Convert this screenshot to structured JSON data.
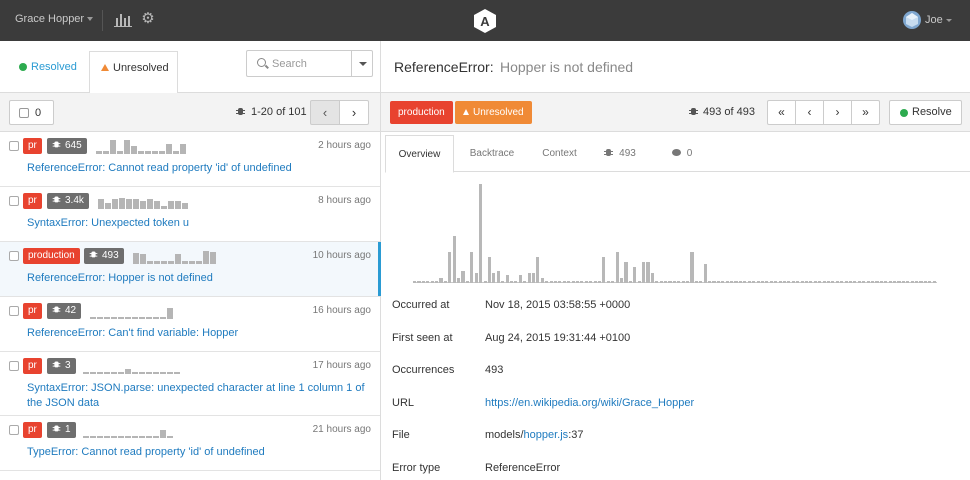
{
  "topbar": {
    "org_name": "Grace Hopper",
    "user_name": "Joe",
    "icons": [
      "stats-icon",
      "gear-icon",
      "app-logo",
      "user-avatar"
    ]
  },
  "left": {
    "tabs": {
      "resolved": "Resolved",
      "unresolved": "Unresolved"
    },
    "search": {
      "placeholder": "Search"
    },
    "list_header": {
      "selected_count": "0",
      "range": "1-20 of 101",
      "prev": "‹",
      "next": "›"
    },
    "issues": [
      {
        "env": "pr",
        "count": "645",
        "time": "2 hours ago",
        "title": "ReferenceError: Cannot read property 'id' of undefined",
        "spark": [
          0.2,
          0.2,
          0.9,
          0.2,
          0.85,
          0.5,
          0.2,
          0.2,
          0.2,
          0.2,
          0.65,
          0.2,
          0.65
        ]
      },
      {
        "env": "pr",
        "count": "3.4k",
        "time": "8 hours ago",
        "title": "SyntaxError: Unexpected token u",
        "spark": [
          0.6,
          0.4,
          0.6,
          0.7,
          0.6,
          0.6,
          0.5,
          0.6,
          0.5,
          0.2,
          0.5,
          0.5,
          0.4
        ]
      },
      {
        "env": "production",
        "count": "493",
        "time": "10 hours ago",
        "title": "ReferenceError: Hopper is not defined",
        "spark": [
          0.7,
          0.6,
          0.2,
          0.2,
          0.2,
          0.2,
          0.6,
          0.2,
          0.2,
          0.2,
          0.8,
          0.75
        ]
      },
      {
        "env": "pr",
        "count": "42",
        "time": "16 hours ago",
        "title": "ReferenceError: Can't find variable: Hopper",
        "spark": [
          0.1,
          0.1,
          0.1,
          0.1,
          0.1,
          0.1,
          0.1,
          0.1,
          0.1,
          0.1,
          0.1,
          0.7
        ]
      },
      {
        "env": "pr",
        "count": "3",
        "time": "17 hours ago",
        "title": "SyntaxError: JSON.parse: unexpected character at line 1 column 1 of the JSON data",
        "spark": [
          0.1,
          0.1,
          0.1,
          0.1,
          0.1,
          0.1,
          0.3,
          0.1,
          0.1,
          0.1,
          0.1,
          0.1,
          0.1,
          0.1
        ]
      },
      {
        "env": "pr",
        "count": "1",
        "time": "21 hours ago",
        "title": "TypeError: Cannot read property 'id' of undefined",
        "spark": [
          0.1,
          0.1,
          0.1,
          0.1,
          0.1,
          0.1,
          0.1,
          0.1,
          0.1,
          0.1,
          0.1,
          0.5,
          0.1
        ]
      }
    ]
  },
  "right": {
    "error_type": "ReferenceError:",
    "error_message": "Hopper is not defined",
    "env_badge": "production",
    "status_badge": "Unresolved",
    "occurrence_position": "493 of 493",
    "nav": {
      "first": "«",
      "prev": "‹",
      "next": "›",
      "last": "»"
    },
    "resolve_label": "Resolve",
    "tabs": {
      "overview": "Overview",
      "backtrace": "Backtrace",
      "context": "Context",
      "occurrences": "493",
      "comments": "0"
    },
    "chart_data": {
      "type": "bar",
      "values": [
        0.02,
        0.02,
        0.02,
        0.02,
        0.02,
        0.02,
        0.05,
        0.02,
        0.3,
        0.45,
        0.05,
        0.12,
        0.02,
        0.3,
        0.1,
        0.95,
        0.02,
        0.25,
        0.1,
        0.12,
        0.02,
        0.08,
        0.02,
        0.02,
        0.08,
        0.02,
        0.1,
        0.1,
        0.25,
        0.05,
        0.02,
        0.02,
        0.02,
        0.02,
        0.02,
        0.02,
        0.02,
        0.02,
        0.02,
        0.02,
        0.02,
        0.02,
        0.02,
        0.25,
        0.02,
        0.02,
        0.3,
        0.05,
        0.2,
        0.02,
        0.15,
        0.02,
        0.2,
        0.2,
        0.1,
        0.02,
        0.02,
        0.02,
        0.02,
        0.02,
        0.02,
        0.02,
        0.02,
        0.3,
        0.02,
        0.02,
        0.18,
        0.02,
        0.02,
        0.02,
        0.02,
        0.02,
        0.02,
        0.02,
        0.02,
        0.02,
        0.02,
        0.02,
        0.02,
        0.02,
        0.02,
        0.02,
        0.02,
        0.02,
        0.02,
        0.02,
        0.02,
        0.02,
        0.02,
        0.02,
        0.02,
        0.02,
        0.02,
        0.02,
        0.02,
        0.02,
        0.02,
        0.02,
        0.02,
        0.02,
        0.02,
        0.02,
        0.02,
        0.02,
        0.02,
        0.02,
        0.02,
        0.02,
        0.02,
        0.02,
        0.02,
        0.02,
        0.02,
        0.02,
        0.02,
        0.02,
        0.02,
        0.02,
        0.02
      ]
    },
    "details": [
      {
        "label": "Occurred at",
        "value": "Nov 18, 2015 03:58:55 +0000"
      },
      {
        "label": "First seen at",
        "value": "Aug 24, 2015 19:31:44 +0100"
      },
      {
        "label": "Occurrences",
        "value": "493"
      },
      {
        "label": "URL",
        "value": "https://en.wikipedia.org/wiki/Grace_Hopper"
      },
      {
        "label": "File",
        "value_prefix": "models/",
        "value_link": "hopper.js",
        "value_suffix": ":37"
      },
      {
        "label": "Error type",
        "value": "ReferenceError"
      }
    ]
  },
  "colors": {
    "accent": "#2a9bd3",
    "danger": "#e8432f",
    "warning": "#f08a36",
    "success": "#2dab4f",
    "topbar": "#3b3b3b"
  }
}
